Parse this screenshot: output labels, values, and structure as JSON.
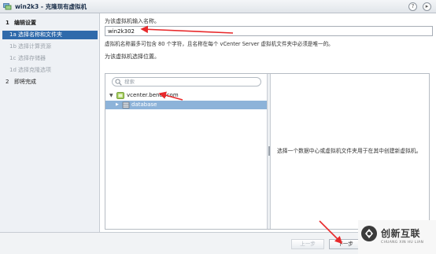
{
  "window": {
    "title": "win2k3 - 克隆现有虚拟机",
    "help_glyph": "?",
    "menu_glyph": "▸"
  },
  "sidebar": {
    "items": [
      {
        "num": "1",
        "label": "编辑设置",
        "state": "main"
      },
      {
        "num": "1a",
        "label": "选择名称和文件夹",
        "state": "active"
      },
      {
        "num": "1b",
        "label": "选择计算资源",
        "state": "disabled"
      },
      {
        "num": "1c",
        "label": "选择存储器",
        "state": "disabled"
      },
      {
        "num": "1d",
        "label": "选择克隆选项",
        "state": "disabled"
      },
      {
        "num": "2",
        "label": "即将完成",
        "state": "main"
      }
    ]
  },
  "form": {
    "name_label": "为该虚拟机输入名称。",
    "name_value": "win2k302",
    "name_hint": "虚拟机名称最多可包含 80 个字符，且名称在每个 vCenter Server 虚拟机文件夹中必须是唯一的。",
    "location_label": "为该虚拟机选择位置。",
    "search_placeholder": "搜索"
  },
  "tree": {
    "root": {
      "label": "vcenter.benet.com",
      "expander": "▼"
    },
    "child": {
      "label": "database",
      "expander": "▶"
    }
  },
  "info": {
    "text": "选择一个数据中心或虚拟机文件夹用于在其中创建新虚拟机。"
  },
  "footer": {
    "back_label": "上一步",
    "next_label": "下一步"
  },
  "watermark": {
    "brand": "创新互联",
    "sub": "CHUANG XIN HU LIAN"
  },
  "colors": {
    "accent": "#2f6aab",
    "selection": "#8db3d9",
    "arrow": "#e8292b"
  }
}
